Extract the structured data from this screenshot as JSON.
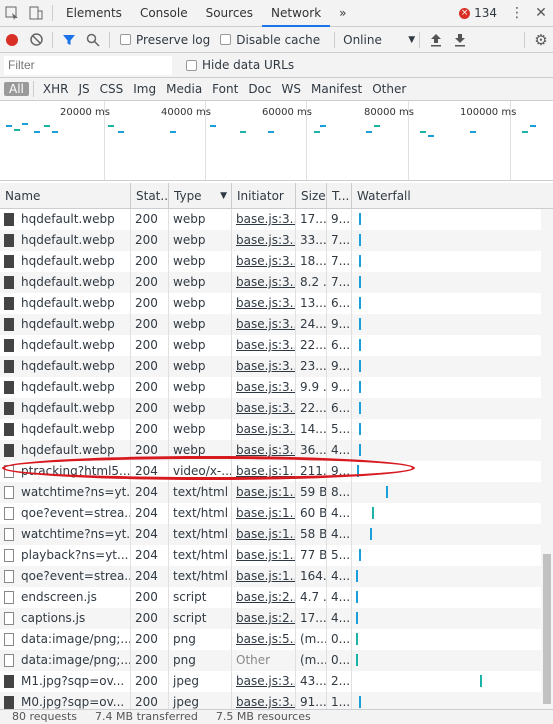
{
  "devtools": {
    "tabs": [
      "Elements",
      "Console",
      "Sources",
      "Network"
    ],
    "active_tab": "Network",
    "more_tabs_glyph": "»",
    "error_count": "134",
    "error_icon": "error-circle-icon",
    "menu_icon": "kebab-menu-icon",
    "close_icon": "close-icon"
  },
  "toolbar": {
    "preserve_log": "Preserve log",
    "disable_cache": "Disable cache",
    "throttle": "Online"
  },
  "filter": {
    "placeholder": "Filter",
    "hide_data_urls": "Hide data URLs",
    "types": [
      "All",
      "XHR",
      "JS",
      "CSS",
      "Img",
      "Media",
      "Font",
      "Doc",
      "WS",
      "Manifest",
      "Other"
    ],
    "active_type": "All"
  },
  "overview": {
    "ticks": [
      "20000 ms",
      "40000 ms",
      "60000 ms",
      "80000 ms",
      "100000 ms"
    ]
  },
  "columns": [
    "Name",
    "Stat...",
    "Type",
    "Initiator",
    "Size",
    "T...",
    "Waterfall"
  ],
  "rows": [
    {
      "name": "hqdefault.webp",
      "status": "200",
      "type": "webp",
      "initiator": "base.js:3...",
      "size": "17...",
      "time": "9...",
      "icon": "image",
      "wf": 0.04,
      "color": "#1a9fd8"
    },
    {
      "name": "hqdefault.webp",
      "status": "200",
      "type": "webp",
      "initiator": "base.js:3...",
      "size": "33...",
      "time": "7...",
      "icon": "image",
      "wf": 0.04,
      "color": "#1a9fd8"
    },
    {
      "name": "hqdefault.webp",
      "status": "200",
      "type": "webp",
      "initiator": "base.js:3...",
      "size": "18...",
      "time": "7...",
      "icon": "image",
      "wf": 0.04,
      "color": "#1a9fd8"
    },
    {
      "name": "hqdefault.webp",
      "status": "200",
      "type": "webp",
      "initiator": "base.js:3...",
      "size": "8.2 ...",
      "time": "7...",
      "icon": "image",
      "wf": 0.04,
      "color": "#1a9fd8"
    },
    {
      "name": "hqdefault.webp",
      "status": "200",
      "type": "webp",
      "initiator": "base.js:3...",
      "size": "13...",
      "time": "6...",
      "icon": "image",
      "wf": 0.04,
      "color": "#1a9fd8"
    },
    {
      "name": "hqdefault.webp",
      "status": "200",
      "type": "webp",
      "initiator": "base.js:3...",
      "size": "24...",
      "time": "9...",
      "icon": "image",
      "wf": 0.04,
      "color": "#1a9fd8"
    },
    {
      "name": "hqdefault.webp",
      "status": "200",
      "type": "webp",
      "initiator": "base.js:3...",
      "size": "22...",
      "time": "6...",
      "icon": "image",
      "wf": 0.04,
      "color": "#1a9fd8"
    },
    {
      "name": "hqdefault.webp",
      "status": "200",
      "type": "webp",
      "initiator": "base.js:3...",
      "size": "23...",
      "time": "9...",
      "icon": "image",
      "wf": 0.04,
      "color": "#1a9fd8"
    },
    {
      "name": "hqdefault.webp",
      "status": "200",
      "type": "webp",
      "initiator": "base.js:3...",
      "size": "9.9 ...",
      "time": "9...",
      "icon": "image",
      "wf": 0.04,
      "color": "#1a9fd8"
    },
    {
      "name": "hqdefault.webp",
      "status": "200",
      "type": "webp",
      "initiator": "base.js:3...",
      "size": "22...",
      "time": "6...",
      "icon": "image",
      "wf": 0.04,
      "color": "#1a9fd8"
    },
    {
      "name": "hqdefault.webp",
      "status": "200",
      "type": "webp",
      "initiator": "base.js:3...",
      "size": "14...",
      "time": "5...",
      "icon": "image",
      "wf": 0.04,
      "color": "#1a9fd8"
    },
    {
      "name": "hqdefault.webp",
      "status": "200",
      "type": "webp",
      "initiator": "base.js:3...",
      "size": "36...",
      "time": "4...",
      "icon": "image",
      "wf": 0.04,
      "color": "#1a9fd8"
    },
    {
      "name": "ptracking?html5...",
      "status": "204",
      "type": "video/x-...",
      "initiator": "base.js:1...",
      "size": "211...",
      "time": "9...",
      "icon": "doc",
      "wf": 0.03,
      "color": "#1a9fd8"
    },
    {
      "name": "watchtime?ns=yt...",
      "status": "204",
      "type": "text/html",
      "initiator": "base.js:1...",
      "size": "59 B",
      "time": "8...",
      "icon": "doc",
      "wf": 0.19,
      "color": "#1a9fd8"
    },
    {
      "name": "qoe?event=strea...",
      "status": "204",
      "type": "text/html",
      "initiator": "base.js:1...",
      "size": "60 B",
      "time": "4...",
      "icon": "doc",
      "wf": 0.11,
      "color": "#1ab3a6"
    },
    {
      "name": "watchtime?ns=yt...",
      "status": "204",
      "type": "text/html",
      "initiator": "base.js:1...",
      "size": "58 B",
      "time": "4...",
      "icon": "doc",
      "wf": 0.1,
      "color": "#1a9fd8"
    },
    {
      "name": "playback?ns=yt...",
      "status": "204",
      "type": "text/html",
      "initiator": "base.js:1...",
      "size": "77 B",
      "time": "5...",
      "icon": "doc",
      "wf": 0.04,
      "color": "#1a9fd8"
    },
    {
      "name": "qoe?event=strea...",
      "status": "204",
      "type": "text/html",
      "initiator": "base.js:1...",
      "size": "164...",
      "time": "4...",
      "icon": "doc",
      "wf": 0.02,
      "color": "#1a9fd8"
    },
    {
      "name": "endscreen.js",
      "status": "200",
      "type": "script",
      "initiator": "base.js:2...",
      "size": "4.7 ...",
      "time": "4...",
      "icon": "doc",
      "wf": 0.02,
      "color": "#1a9fd8"
    },
    {
      "name": "captions.js",
      "status": "200",
      "type": "script",
      "initiator": "base.js:2...",
      "size": "17...",
      "time": "4...",
      "icon": "doc",
      "wf": 0.02,
      "color": "#1a9fd8"
    },
    {
      "name": "data:image/png;...",
      "status": "200",
      "type": "png",
      "initiator": "base.js:5...",
      "size": "(m...",
      "time": "0...",
      "icon": "doc",
      "wf": 0.02,
      "color": "#1ab3a6"
    },
    {
      "name": "data:image/png;...",
      "status": "200",
      "type": "png",
      "initiator": "Other",
      "size": "(m...",
      "time": "0...",
      "icon": "doc",
      "wf": 0.02,
      "color": "#1ab3a6"
    },
    {
      "name": "M1.jpg?sqp=ov...",
      "status": "200",
      "type": "jpeg",
      "initiator": "base.js:3...",
      "size": "43...",
      "time": "2...",
      "icon": "image",
      "wf": 0.71,
      "color": "#1ab3a6"
    },
    {
      "name": "M0.jpg?sqp=ov...",
      "status": "200",
      "type": "jpeg",
      "initiator": "base.js:3...",
      "size": "91...",
      "time": "1...",
      "icon": "image",
      "wf": 0.04,
      "color": "#1a9fd8"
    }
  ],
  "status": {
    "requests": "80 requests",
    "transferred": "7.4 MB transferred",
    "resources": "7.5 MB resources"
  },
  "colors": {
    "accent": "#1a73e8",
    "record": "#d93025",
    "annotation": "#d71920"
  }
}
